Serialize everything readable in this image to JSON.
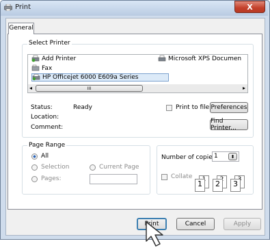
{
  "window": {
    "title": "Print",
    "close_label": "X"
  },
  "tabs": [
    {
      "label": "General"
    }
  ],
  "select_printer": {
    "legend": "Select Printer",
    "printers": [
      {
        "label": "Add Printer"
      },
      {
        "label": "Microsoft XPS Documen"
      },
      {
        "label": "Fax"
      },
      {
        "label": "HP Officejet 6000 E609a Series"
      }
    ],
    "scroll_thumb": "III",
    "status_label": "Status:",
    "status_value": "Ready",
    "location_label": "Location:",
    "comment_label": "Comment:",
    "print_to_file_label": "Print to file",
    "preferences_label": "Preferences",
    "find_printer_label": "Find Printer..."
  },
  "page_range": {
    "legend": "Page Range",
    "all_label": "All",
    "selection_label": "Selection",
    "current_page_label": "Current Page",
    "pages_label": "Pages:"
  },
  "copies": {
    "number_label": "Number of copies:",
    "number_value": "1",
    "collate_label": "Collate",
    "collate_icons": [
      "1",
      "1",
      "2",
      "2",
      "3",
      "3"
    ]
  },
  "buttons": {
    "print": "Print",
    "cancel": "Cancel",
    "apply": "Apply"
  }
}
